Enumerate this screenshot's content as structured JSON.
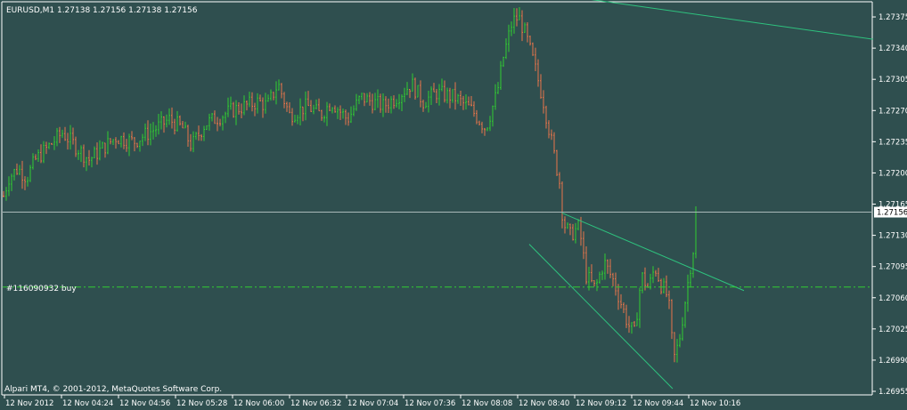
{
  "header": {
    "symbol_info": "EURUSD,M1  1.27138 1.27156 1.27138 1.27156"
  },
  "footer": {
    "copyright": "Alpari MT4, © 2001-2012, MetaQuotes Software Corp."
  },
  "order": {
    "label": "#116090932 buy",
    "price": 1.27072
  },
  "colors": {
    "background": "#2f4f4f",
    "foreground": "#ffffff",
    "bull": "#32cd32",
    "bear": "#e9764b",
    "trendline": "#2ec27e",
    "order_line": "#32cd32",
    "bid_line": "#a9b9b9"
  },
  "chart_data": {
    "type": "candlestick",
    "symbol": "EURUSD",
    "timeframe": "M1",
    "ohlc_last": {
      "open": 1.27138,
      "high": 1.27156,
      "low": 1.27138,
      "close": 1.27156
    },
    "current_price": 1.27156,
    "current_price_label": "1.27156",
    "ylim": [
      1.26955,
      1.2739
    ],
    "y_ticks": [
      "1.27375",
      "1.27340",
      "1.27305",
      "1.27270",
      "1.27235",
      "1.27200",
      "1.27165",
      "1.27130",
      "1.27095",
      "1.27060",
      "1.27025",
      "1.26990",
      "1.26955"
    ],
    "x_ticks": [
      "12 Nov 2012",
      "12 Nov 04:24",
      "12 Nov 04:56",
      "12 Nov 05:28",
      "12 Nov 06:00",
      "12 Nov 06:32",
      "12 Nov 07:04",
      "12 Nov 07:36",
      "12 Nov 08:08",
      "12 Nov 08:40",
      "12 Nov 09:12",
      "12 Nov 09:44",
      "12 Nov 10:16"
    ],
    "anchors": [
      [
        0,
        1.2716
      ],
      [
        10,
        1.27195
      ],
      [
        20,
        1.27205
      ],
      [
        30,
        1.27195
      ],
      [
        40,
        1.27215
      ],
      [
        60,
        1.27235
      ],
      [
        70,
        1.27245
      ],
      [
        85,
        1.2723
      ],
      [
        100,
        1.27215
      ],
      [
        130,
        1.2724
      ],
      [
        150,
        1.27235
      ],
      [
        175,
        1.2725
      ],
      [
        190,
        1.2726
      ],
      [
        205,
        1.2725
      ],
      [
        215,
        1.2723
      ],
      [
        230,
        1.27255
      ],
      [
        260,
        1.2727
      ],
      [
        290,
        1.2728
      ],
      [
        300,
        1.27275
      ],
      [
        312,
        1.273
      ],
      [
        325,
        1.27265
      ],
      [
        345,
        1.27275
      ],
      [
        360,
        1.27265
      ],
      [
        372,
        1.2728
      ],
      [
        390,
        1.2726
      ],
      [
        405,
        1.27285
      ],
      [
        430,
        1.27275
      ],
      [
        445,
        1.27285
      ],
      [
        462,
        1.273
      ],
      [
        475,
        1.2728
      ],
      [
        490,
        1.2729
      ],
      [
        510,
        1.27285
      ],
      [
        530,
        1.2727
      ],
      [
        545,
        1.2725
      ],
      [
        558,
        1.2729
      ],
      [
        565,
        1.2733
      ],
      [
        575,
        1.2737
      ],
      [
        582,
        1.27375
      ],
      [
        590,
        1.27355
      ],
      [
        600,
        1.2732
      ],
      [
        610,
        1.2728
      ],
      [
        620,
        1.2723
      ],
      [
        628,
        1.2719
      ],
      [
        632,
        1.27145
      ],
      [
        640,
        1.2713
      ],
      [
        650,
        1.2714
      ],
      [
        658,
        1.27085
      ],
      [
        668,
        1.2707
      ],
      [
        678,
        1.271
      ],
      [
        688,
        1.2708
      ],
      [
        695,
        1.2706
      ],
      [
        705,
        1.2703
      ],
      [
        712,
        1.2702
      ],
      [
        720,
        1.27085
      ],
      [
        728,
        1.2707
      ],
      [
        735,
        1.27095
      ],
      [
        742,
        1.27075
      ],
      [
        750,
        1.2706
      ],
      [
        756,
        1.2699
      ],
      [
        762,
        1.2701
      ],
      [
        768,
        1.2705
      ],
      [
        774,
        1.2709
      ],
      [
        779,
        1.2712
      ],
      [
        781,
        1.27156
      ]
    ],
    "trendlines": [
      {
        "from": {
          "x": 660,
          "price": 1.27395
        },
        "to": {
          "x": 980,
          "price": 1.2735
        }
      },
      {
        "from": {
          "x": 631,
          "price": 1.27155
        },
        "to": {
          "x": 835,
          "price": 1.27068
        }
      },
      {
        "from": {
          "x": 594,
          "price": 1.2712
        },
        "to": {
          "x": 755,
          "price": 1.26958
        }
      }
    ],
    "grid": false,
    "legend": "none"
  }
}
